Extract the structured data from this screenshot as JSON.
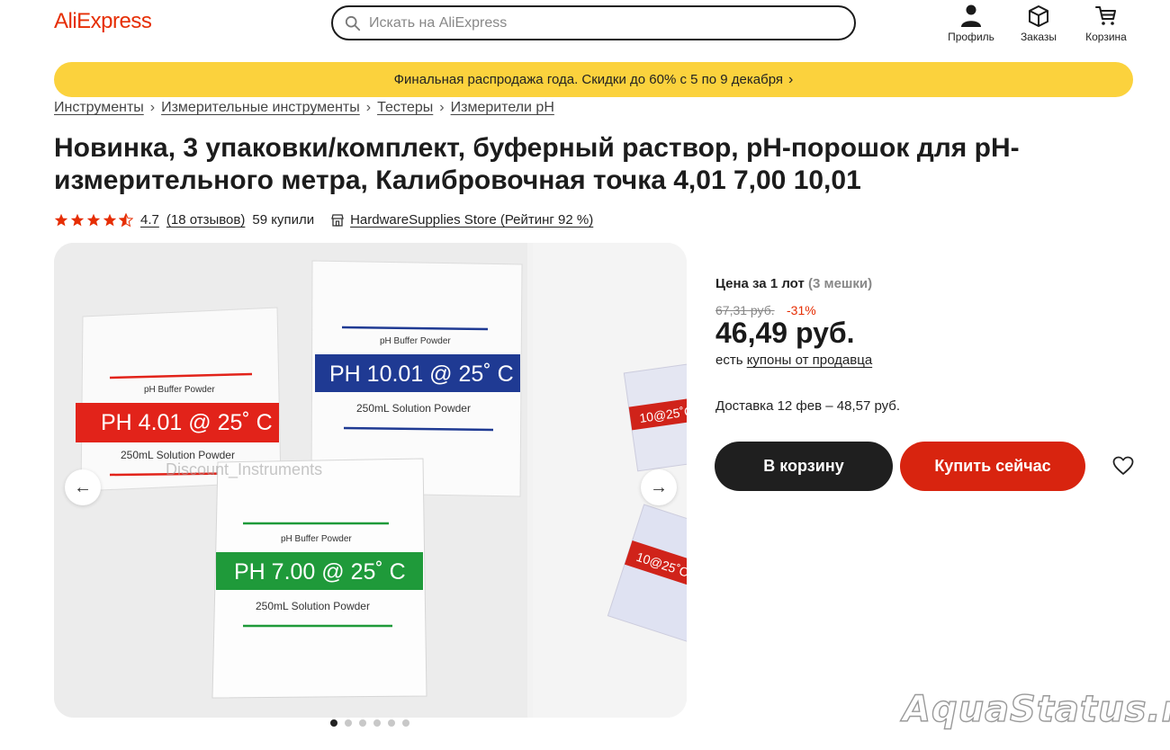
{
  "header": {
    "logo": "AliExpress",
    "search_placeholder": "Искать на AliExpress",
    "nav": [
      {
        "label": "Профиль",
        "icon": "user-icon"
      },
      {
        "label": "Заказы",
        "icon": "box-icon"
      },
      {
        "label": "Корзина",
        "icon": "cart-icon"
      }
    ]
  },
  "banner": {
    "text": "Финальная распродажа года. Скидки до 60% с 5 по 9 декабря",
    "chevron": "›"
  },
  "breadcrumbs": [
    "Инструменты",
    "Измерительные инструменты",
    "Тестеры",
    "Измерители pH"
  ],
  "product": {
    "title": "Новинка, 3 упаковки/комплект, буферный раствор, pH-порошок для pH-измерительного метра, Калибровочная точка 4,01 7,00 10,01",
    "rating": "4.7",
    "stars": 4.7,
    "reviews": "(18 отзывов)",
    "sold": "59 купили",
    "store": "HardwareSupplies Store (Рейтинг 92 %)"
  },
  "gallery": {
    "images": [
      {
        "packets": [
          {
            "label": "pH Buffer Powder",
            "ph": "PH 4.01 @ 25˚ C",
            "solution": "250mL Solution Powder",
            "color": "#e2231a"
          },
          {
            "label": "pH Buffer Powder",
            "ph": "PH 10.01 @ 25˚ C",
            "solution": "250mL Solution Powder",
            "color": "#1f3a93"
          },
          {
            "label": "pH Buffer Powder",
            "ph": "PH 7.00 @ 25˚ C",
            "solution": "250mL Solution Powder",
            "color": "#1f9a3a"
          }
        ],
        "watermark": "Discount_Instruments"
      },
      {
        "snippets": [
          "10@25˚C",
          "10@25˚C"
        ]
      }
    ],
    "prev_icon": "←",
    "next_icon": "→",
    "dots": 6,
    "active_dot": 0
  },
  "pricing": {
    "lot_label": "Цена за 1 лот",
    "lot_qty": "(3 мешки)",
    "old_price": "67,31 руб.",
    "discount": "-31%",
    "price": "46,49 руб.",
    "coupon_prefix": "есть",
    "coupon_link": "купоны от продавца",
    "delivery": "Доставка 12 фев – 48,57 руб.",
    "add_to_cart": "В корзину",
    "buy_now": "Купить сейчас"
  },
  "colors": {
    "brand": "#e62e04",
    "banner": "#fbd23d",
    "buy": "#d8240f",
    "cart": "#1f1f1f",
    "star": "#e62e04"
  },
  "site_watermark": "AquaStatus.ru"
}
